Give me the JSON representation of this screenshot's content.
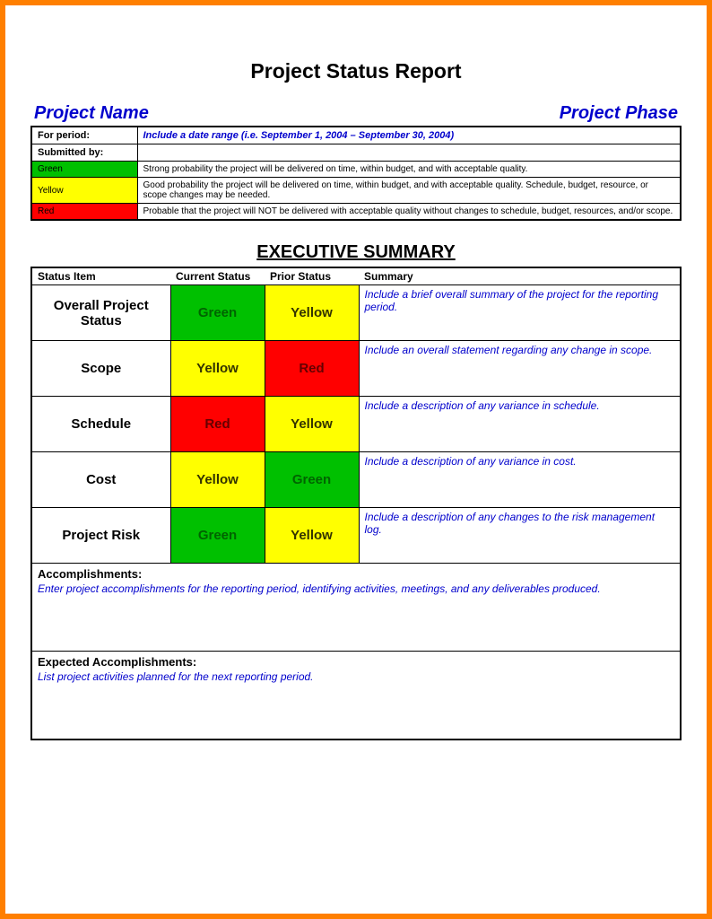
{
  "page_title": "Project Status Report",
  "header": {
    "name_label": "Project Name",
    "phase_label": "Project Phase"
  },
  "info": {
    "period_label": "For period:",
    "period_hint": "Include a date range (i.e. September 1, 2004 – September 30, 2004)",
    "submitted_label": "Submitted by:"
  },
  "legend": [
    {
      "key": "Green",
      "color": "g",
      "desc": "Strong probability the project will be delivered on time, within budget, and with acceptable quality."
    },
    {
      "key": "Yellow",
      "color": "y",
      "desc": "Good probability the project will be delivered on time, within budget, and with acceptable quality. Schedule, budget, resource, or scope changes may be needed."
    },
    {
      "key": "Red",
      "color": "r",
      "desc": "Probable that the project will NOT be delivered with acceptable quality without changes to schedule, budget, resources, and/or scope."
    }
  ],
  "exec_heading": "EXECUTIVE SUMMARY",
  "columns": {
    "c1": "Status Item",
    "c2": "Current Status",
    "c3": "Prior Status",
    "c4": "Summary"
  },
  "rows": [
    {
      "label": "Overall Project Status",
      "curr": "Green",
      "curr_c": "g-cell",
      "prior": "Yellow",
      "prior_c": "y-cell",
      "sum": "Include a brief overall summary of the project for the reporting period."
    },
    {
      "label": "Scope",
      "curr": "Yellow",
      "curr_c": "y-cell",
      "prior": "Red",
      "prior_c": "r-cell",
      "sum": "Include an overall statement regarding any change in scope."
    },
    {
      "label": "Schedule",
      "curr": "Red",
      "curr_c": "r-cell",
      "prior": "Yellow",
      "prior_c": "y-cell",
      "sum": "Include a description of any variance in schedule."
    },
    {
      "label": "Cost",
      "curr": "Yellow",
      "curr_c": "y-cell",
      "prior": "Green",
      "prior_c": "g-cell",
      "sum": "Include a description of any variance in cost."
    },
    {
      "label": "Project Risk",
      "curr": "Green",
      "curr_c": "g-cell",
      "prior": "Yellow",
      "prior_c": "y-cell",
      "sum": "Include a description of any changes to the risk management log."
    }
  ],
  "accomp": {
    "head": "Accomplishments:",
    "body": "Enter project accomplishments for the reporting period, identifying activities, meetings, and any deliverables produced."
  },
  "expected": {
    "head": "Expected Accomplishments:",
    "body": "List project activities planned for the next reporting period."
  }
}
